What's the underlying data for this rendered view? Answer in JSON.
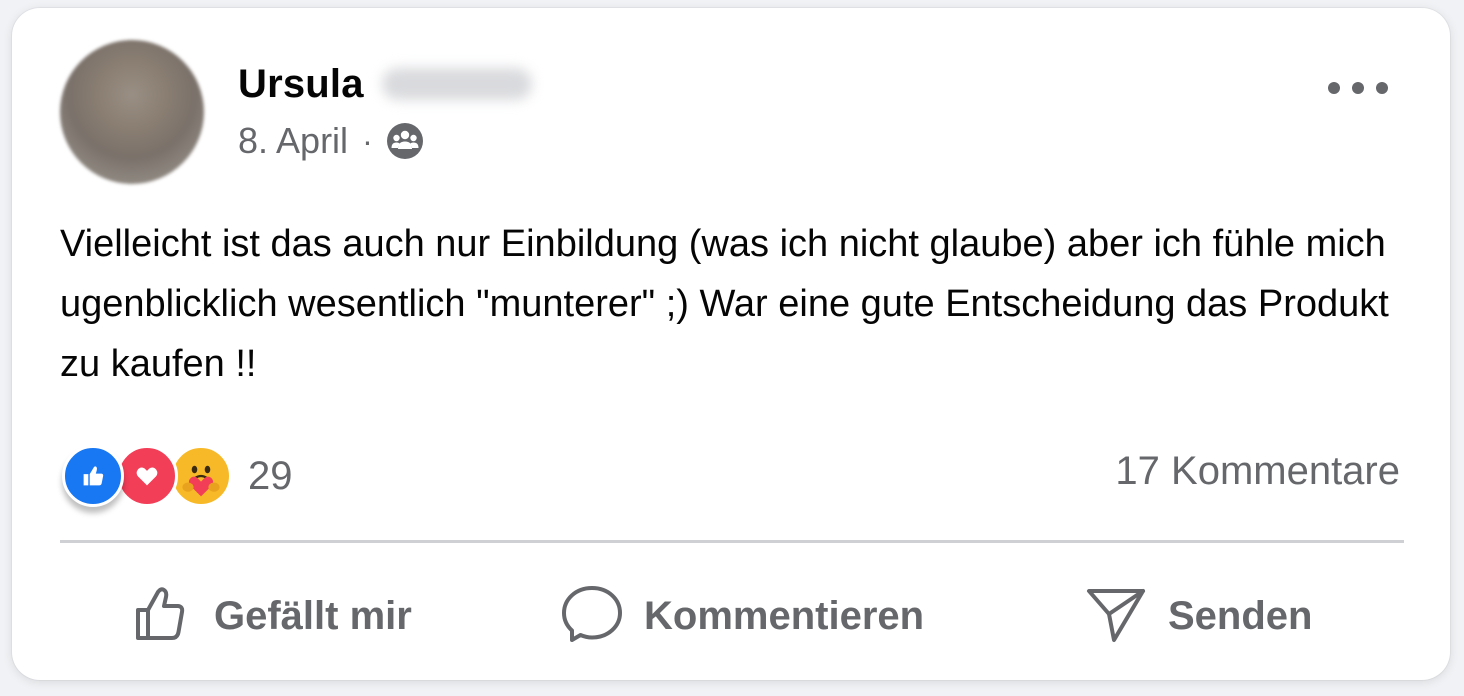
{
  "post": {
    "author": {
      "name": "Ursula"
    },
    "date": "8. April",
    "separator": "·",
    "audience_icon": "group-icon",
    "text": "Vielleicht ist das auch nur Einbildung (was ich nicht glaube) aber ich fühle mich ugenblicklich wesentlich \"munterer\" ;) War eine gute Entscheidung das Produkt zu kaufen !!",
    "reactions": {
      "types": [
        "like-icon",
        "love-icon",
        "care-icon"
      ],
      "count": "29"
    },
    "comments_label": "17 Kommentare",
    "actions": {
      "like_label": "Gefällt mir",
      "comment_label": "Kommentieren",
      "send_label": "Senden"
    }
  },
  "colors": {
    "like": "#1877f2",
    "love": "#f33e58",
    "care": "#f7b928",
    "secondary_text": "#65676b",
    "primary_text": "#050505"
  }
}
